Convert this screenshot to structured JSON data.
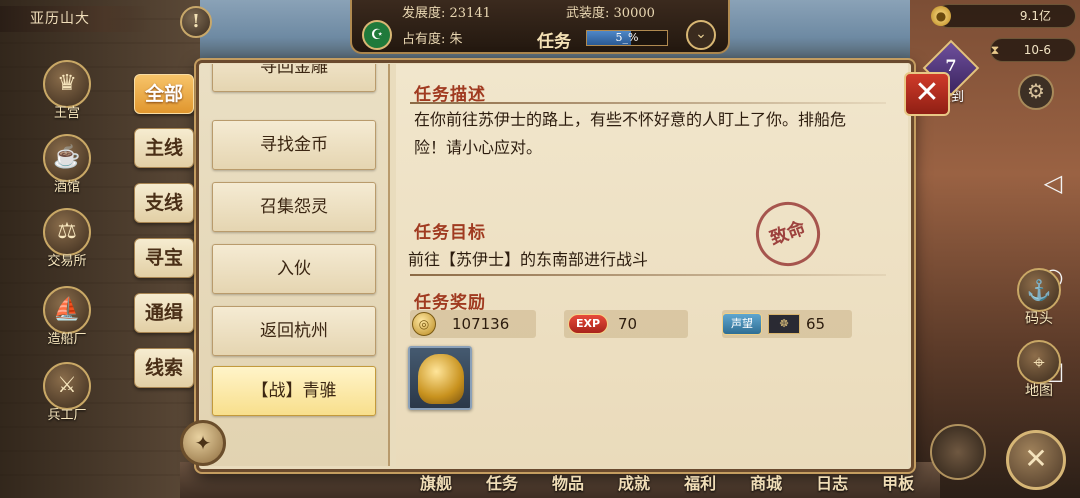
{
  "hud": {
    "city_name": "亚历山大",
    "alert_icon": "!",
    "development_label": "发展度:",
    "development_value": "23141",
    "military_label": "武装度:",
    "military_value": "30000",
    "occupancy_label": "占有度:",
    "occupancy_value": "朱",
    "task_label": "任务",
    "progress_text": "5_%",
    "gold": "9.1亿",
    "date": "10-6"
  },
  "left_nav": [
    {
      "label": "王宫",
      "icon": "crown-icon"
    },
    {
      "label": "酒馆",
      "icon": "mug-icon"
    },
    {
      "label": "交易所",
      "icon": "scales-icon"
    },
    {
      "label": "造船厂",
      "icon": "ship-icon"
    },
    {
      "label": "兵工厂",
      "icon": "chest-icon"
    }
  ],
  "tabs": [
    "全部",
    "主线",
    "支线",
    "寻宝",
    "通缉",
    "线索"
  ],
  "active_tab": 0,
  "task_list": [
    "寻回金雕",
    "寻找金币",
    "召集怨灵",
    "入伙",
    "返回杭州",
    "【战】青骓"
  ],
  "selected_task": 5,
  "detail": {
    "desc_title": "任务描述",
    "desc_text": "在你前往苏伊士的路上，有些不怀好意的人盯上了你。排船危险！请小心应对。",
    "goal_title": "任务目标",
    "goal_text": "前往【苏伊士】的东南部进行战斗",
    "stamp_text": "致命",
    "reward_title": "任务奖励",
    "reward_coin": "107136",
    "reward_exp_label": "EXP",
    "reward_exp": "70",
    "reward_fame_label": "声望",
    "reward_merit": "65"
  },
  "right_panel": {
    "signin_num": "7",
    "signin_label": "签到",
    "dock_label": "码头",
    "map_label": "地图"
  },
  "bottom_bar": [
    "旗舰",
    "任务",
    "物品",
    "成就",
    "福利",
    "商城",
    "日志",
    "甲板"
  ],
  "colors": {
    "accent_red": "#a03a20",
    "tab_active": "#e0962e",
    "parchment": "#f1e6cc"
  }
}
